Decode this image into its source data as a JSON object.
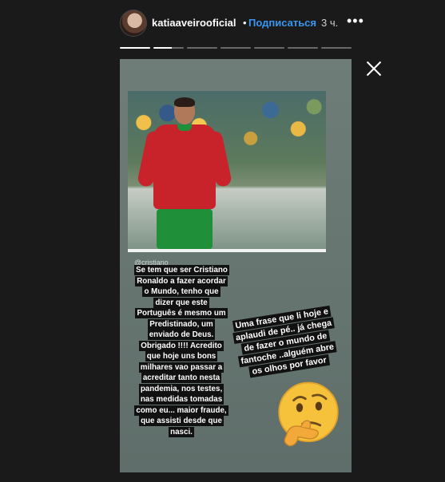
{
  "header": {
    "username": "katiaaveirooficial",
    "separator": "•",
    "subscribe_label": "Подписаться",
    "time_ago": "3 ч.",
    "more_label": "•••"
  },
  "progress": {
    "segments_total": 7,
    "segments_done": 1,
    "current_segment_fill": 0.6
  },
  "story": {
    "mention": "@cristiano",
    "caption_left": "Se tem que ser Cristiano Ronaldo a fazer acordar o Mundo, tenho que dizer que este Português é mesmo um Predistinado, um enviado de Deus. Obrigado !!!! Acredito que hoje uns bons milhares vao passar a acreditar tanto nesta pandemia, nos testes, nas medidas tomadas como eu... maior fraude, que assisti desde que nasci.",
    "caption_right": "Uma frase que li hoje e aplaudi de pé.. já chega de fazer o mundo de fantoche ..alguém abre os olhos por favor",
    "emoji": "thinking-face",
    "background_color": "#6a7873"
  },
  "icons": {
    "close": "close-icon",
    "more": "more-options-icon"
  }
}
